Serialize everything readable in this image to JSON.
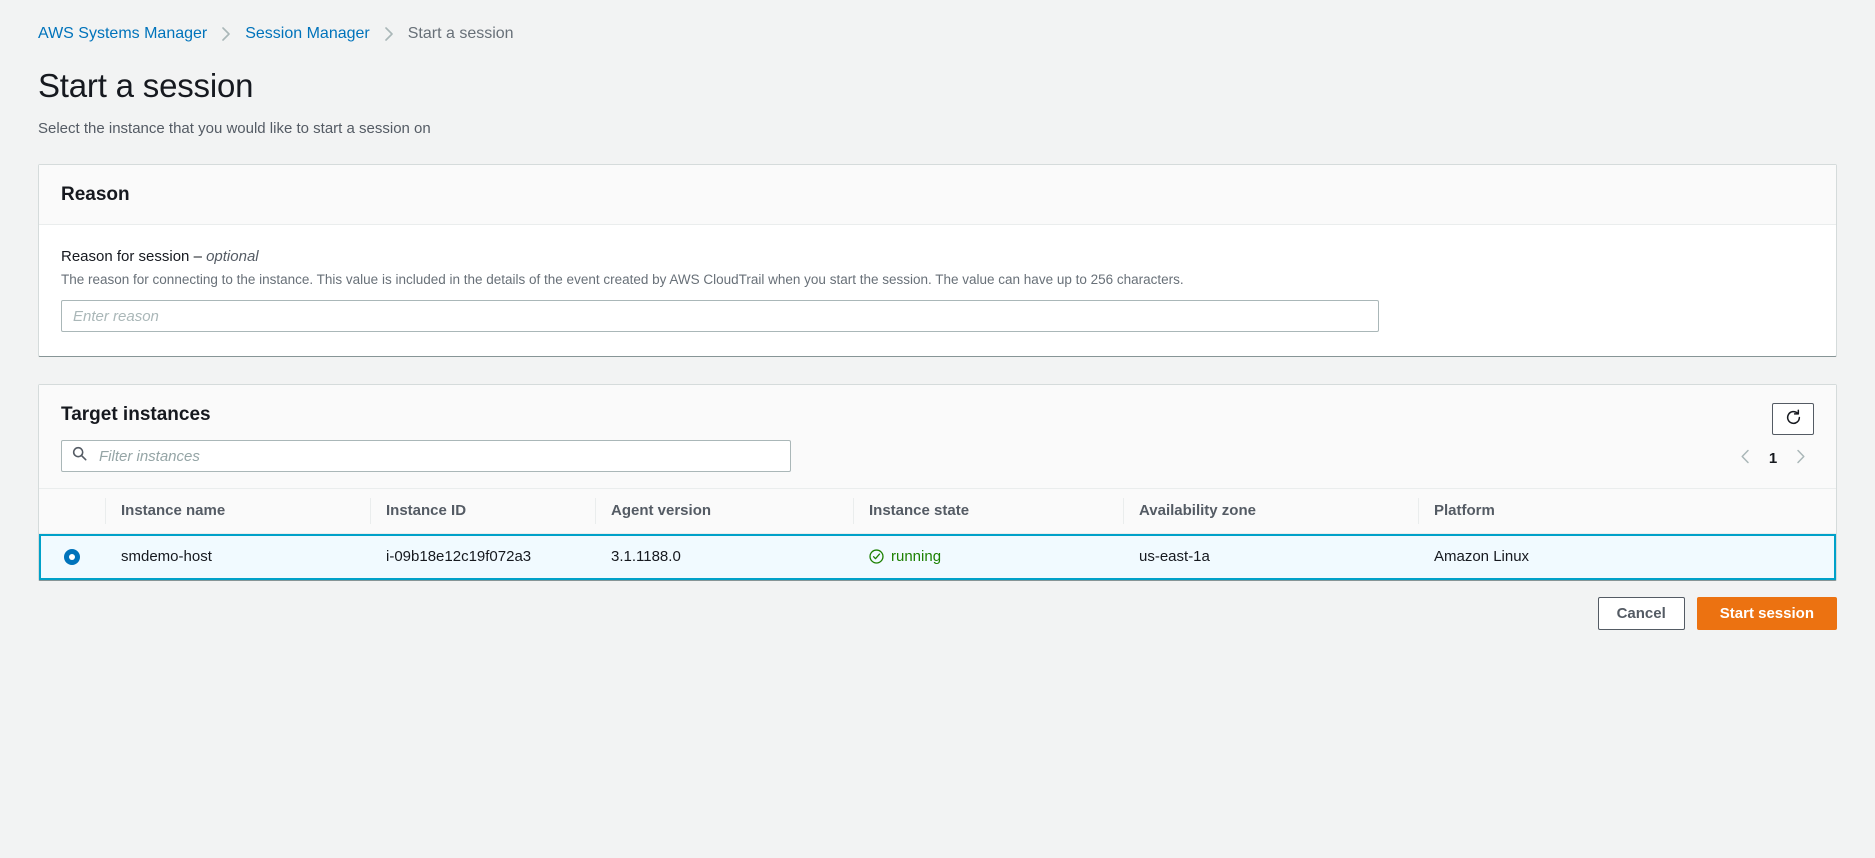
{
  "breadcrumb": {
    "items": [
      {
        "label": "AWS Systems Manager",
        "type": "link"
      },
      {
        "label": "Session Manager",
        "type": "link"
      },
      {
        "label": "Start a session",
        "type": "current"
      }
    ]
  },
  "page": {
    "title": "Start a session",
    "subtitle": "Select the instance that you would like to start a session on"
  },
  "reason_card": {
    "header": "Reason",
    "field_label": "Reason for session – ",
    "field_label_optional": "optional",
    "field_description": "The reason for connecting to the instance. This value is included in the details of the event created by AWS CloudTrail when you start the session. The value can have up to 256 characters.",
    "input_value": "",
    "input_placeholder": "Enter reason"
  },
  "instances_card": {
    "header": "Target instances",
    "filter_value": "",
    "filter_placeholder": "Filter instances",
    "refresh_label": "refresh-icon",
    "pagination": {
      "previous_label": "previous-page",
      "current_page": "1",
      "next_label": "next-page"
    },
    "columns": [
      "Instance name",
      "Instance ID",
      "Agent version",
      "Instance state",
      "Availability zone",
      "Platform"
    ],
    "rows": [
      {
        "selected": true,
        "instance_name": "smdemo-host",
        "instance_id": "i-09b18e12c19f072a3",
        "agent_version": "3.1.1188.0",
        "instance_state": "running",
        "availability_zone": "us-east-1a",
        "platform": "Amazon Linux"
      }
    ]
  },
  "actions": {
    "cancel_label": "Cancel",
    "start_session_label": "Start session"
  },
  "colors": {
    "link": "#0073bb",
    "primary_button": "#ec7211",
    "selected_row_border": "#00a1c9",
    "selected_row_bg": "#f1faff",
    "running_green": "#1d8102",
    "page_bg": "#f2f3f3"
  }
}
